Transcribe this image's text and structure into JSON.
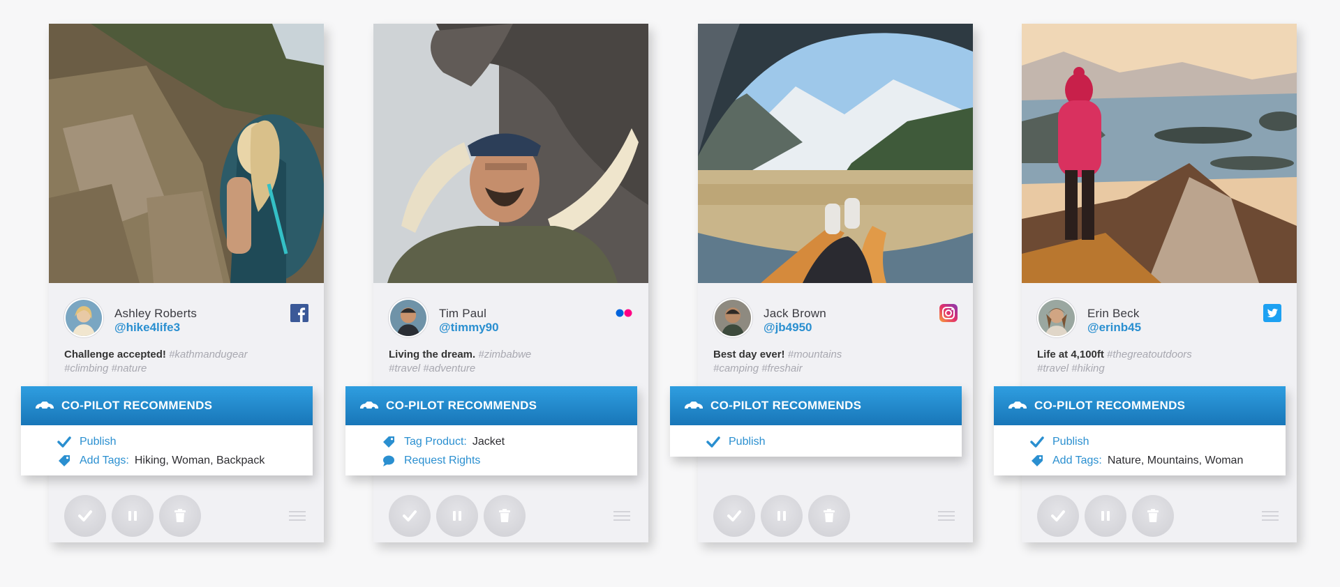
{
  "banner_title": "CO-PILOT RECOMMENDS",
  "cards": [
    {
      "name": "Ashley Roberts",
      "handle": "@hike4life3",
      "network": "facebook",
      "caption_lead": "Challenge accepted!",
      "caption_tags_1": "#kathmandugear",
      "caption_tags_2": "#climbing #nature",
      "recommendations": [
        {
          "icon": "checkmark-icon",
          "label": "Publish",
          "value": ""
        },
        {
          "icon": "tag-icon",
          "label": "Add Tags:",
          "value": "Hiking, Woman, Backpack"
        }
      ]
    },
    {
      "name": "Tim Paul",
      "handle": "@timmy90",
      "network": "flickr",
      "caption_lead": "Living the dream.",
      "caption_tags_1": "#zimbabwe",
      "caption_tags_2": "#travel #adventure",
      "recommendations": [
        {
          "icon": "tag-icon",
          "label": "Tag Product:",
          "value": "Jacket"
        },
        {
          "icon": "chat-bubble-icon",
          "label": "Request Rights",
          "value": ""
        }
      ]
    },
    {
      "name": "Jack Brown",
      "handle": "@jb4950",
      "network": "instagram",
      "caption_lead": "Best day ever!",
      "caption_tags_1": "#mountains",
      "caption_tags_2": "#camping #freshair",
      "recommendations": [
        {
          "icon": "checkmark-icon",
          "label": "Publish",
          "value": ""
        }
      ]
    },
    {
      "name": "Erin Beck",
      "handle": "@erinb45",
      "network": "twitter",
      "caption_lead": "Life at 4,100ft",
      "caption_tags_1": "#thegreatoutdoors",
      "caption_tags_2": "#travel #hiking",
      "recommendations": [
        {
          "icon": "checkmark-icon",
          "label": "Publish",
          "value": ""
        },
        {
          "icon": "tag-icon",
          "label": "Add Tags:",
          "value": "Nature, Mountains, Woman"
        }
      ]
    }
  ],
  "colors": {
    "accent": "#2a8fd0",
    "banner_top": "#2f9ee0",
    "banner_bottom": "#1876b8",
    "facebook": "#3b5998",
    "twitter": "#1da1f2",
    "flickr_blue": "#0063dc",
    "flickr_pink": "#ff0084"
  }
}
